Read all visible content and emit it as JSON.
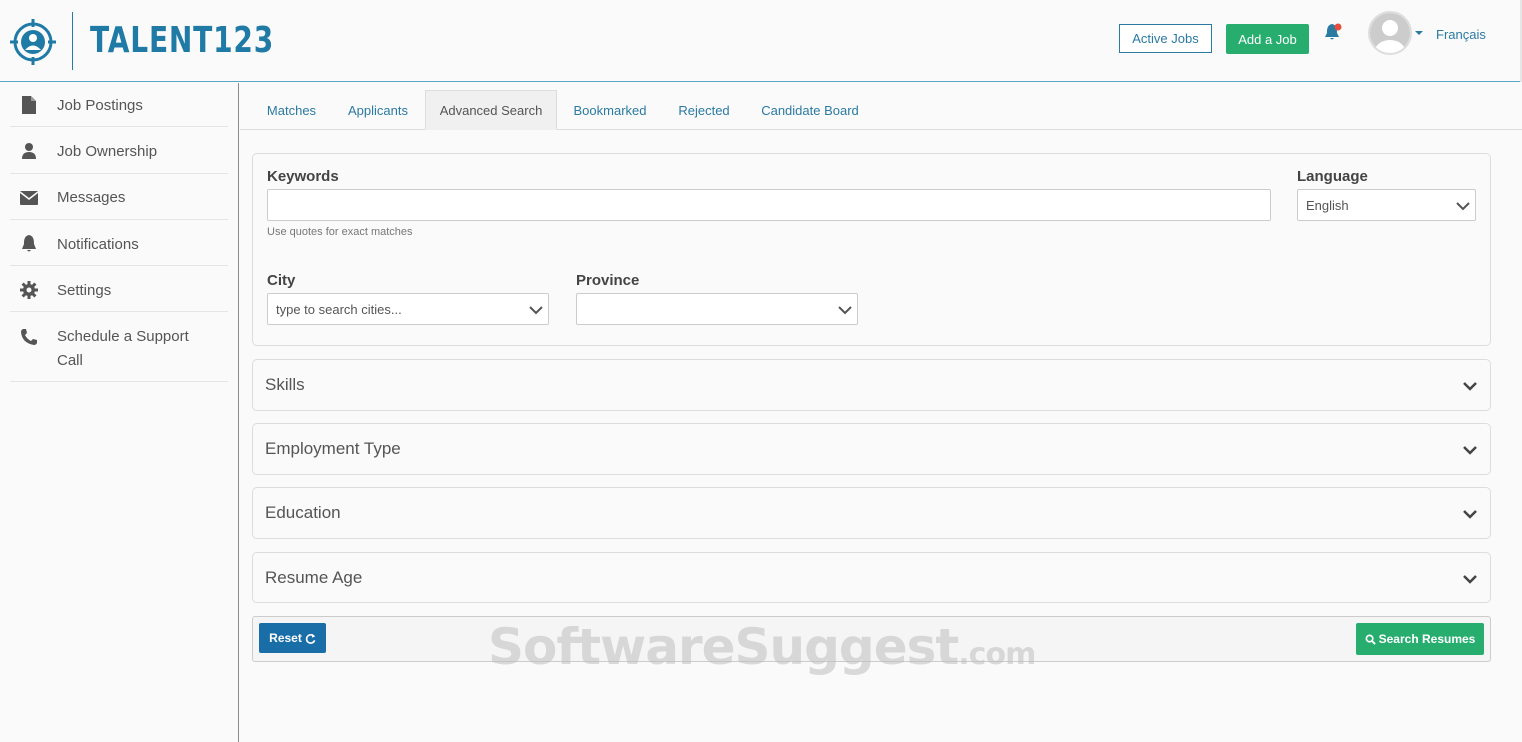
{
  "brand": {
    "name": "TALENT123"
  },
  "header": {
    "active_jobs": "Active Jobs",
    "add_job": "Add a Job",
    "language_link": "Français"
  },
  "sidebar": {
    "items": [
      {
        "label": "Job Postings",
        "icon": "document-icon"
      },
      {
        "label": "Job Ownership",
        "icon": "user-icon"
      },
      {
        "label": "Messages",
        "icon": "envelope-icon"
      },
      {
        "label": "Notifications",
        "icon": "bell-icon"
      },
      {
        "label": "Settings",
        "icon": "gear-icon"
      },
      {
        "label": "Schedule a Support Call",
        "icon": "phone-icon"
      }
    ]
  },
  "tabs": [
    {
      "label": "Matches"
    },
    {
      "label": "Applicants"
    },
    {
      "label": "Advanced Search",
      "active": true
    },
    {
      "label": "Bookmarked"
    },
    {
      "label": "Rejected"
    },
    {
      "label": "Candidate Board"
    }
  ],
  "search": {
    "keywords_label": "Keywords",
    "keywords_value": "",
    "keywords_help": "Use quotes for exact matches",
    "language_label": "Language",
    "language_value": "English",
    "city_label": "City",
    "city_placeholder": "type to search cities...",
    "province_label": "Province",
    "province_value": ""
  },
  "accordions": [
    {
      "title": "Skills"
    },
    {
      "title": "Employment Type"
    },
    {
      "title": "Education"
    },
    {
      "title": "Resume Age"
    }
  ],
  "actions": {
    "reset": "Reset",
    "search": "Search Resumes"
  },
  "watermark": {
    "main": "SoftwareSuggest",
    "suffix": ".com"
  },
  "colors": {
    "brand_blue": "#1f7ba6",
    "green": "#27ae6f",
    "reset_blue": "#1a6ea8"
  }
}
